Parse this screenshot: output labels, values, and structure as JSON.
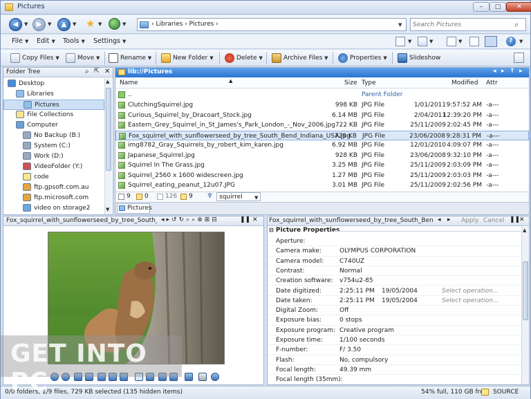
{
  "window": {
    "title": "Pictures",
    "min": "–",
    "max": "□",
    "close": "✕"
  },
  "address": {
    "crumbs": "›  Libraries  ›  Pictures  ›",
    "search_placeholder": "Search Pictures"
  },
  "menu": [
    "File",
    "Edit",
    "Tools",
    "Settings"
  ],
  "toolbar": [
    "Copy Files",
    "Move",
    "Rename",
    "New Folder",
    "Delete",
    "Archive Files",
    "Properties",
    "Slideshow"
  ],
  "tree": {
    "title": "Folder Tree",
    "items": [
      "Desktop",
      "Libraries",
      "Pictures",
      "File Collections",
      "Computer",
      "No Backup (B:)",
      "System (C:)",
      "Work (D:)",
      "VideoFolder (Y:)",
      "code",
      "ftp.gpsoft.com.au",
      "ftp.microsoft.com",
      "video on storage2"
    ]
  },
  "files": {
    "path": "lib://Pictures",
    "columns": [
      "Name",
      "Size",
      "Type",
      "Modified",
      "Attr"
    ],
    "parent": {
      "name": "..",
      "type": "Parent Folder"
    },
    "rows": [
      {
        "name": "ClutchingSquirrel.jpg",
        "size": "998 KB",
        "type": "JPG File",
        "date": "1/01/2011",
        "time": "9:57:52 AM",
        "attr": "-a---"
      },
      {
        "name": "Curious_Squirrel_by_Dracoart_Stock.jpg",
        "size": "6.14 MB",
        "type": "JPG File",
        "date": "2/04/2011",
        "time": "12:39:20 PM",
        "attr": "-a---"
      },
      {
        "name": "Eastern_Grey_Squirrel_in_St_James's_Park_London_-_Nov_2006.jpg",
        "size": "722 KB",
        "type": "JPG File",
        "date": "25/11/2009",
        "time": "2:02:45 PM",
        "attr": "-a---"
      },
      {
        "name": "Fox_squirrel_with_sunflowerseed_by_tree_South_Bend_Indiana_USA.jpg",
        "size": "729 KB",
        "type": "JPG File",
        "date": "23/06/2008",
        "time": "9:28:31 PM",
        "attr": "-a---"
      },
      {
        "name": "img8782_Gray_Squirrels_by_robert_kim_karen.jpg",
        "size": "6.92 MB",
        "type": "JPG File",
        "date": "12/01/2010",
        "time": "4:09:07 PM",
        "attr": "-a---"
      },
      {
        "name": "Japanese_Squirrel.jpg",
        "size": "928 KB",
        "type": "JPG File",
        "date": "23/06/2008",
        "time": "9:32:10 PM",
        "attr": "-a---"
      },
      {
        "name": "Squirrel In The Grass.jpg",
        "size": "3.25 MB",
        "type": "JPG File",
        "date": "25/11/2009",
        "time": "2:03:09 PM",
        "attr": "-a---"
      },
      {
        "name": "Squirrel_2560 x 1600 widescreen.jpg",
        "size": "1.27 MB",
        "type": "JPG File",
        "date": "25/11/2009",
        "time": "2:03:03 PM",
        "attr": "-a---"
      },
      {
        "name": "Squirrel_eating_peanut_12u07.JPG",
        "size": "3.01 MB",
        "type": "JPG File",
        "date": "25/11/2009",
        "time": "2:02:56 PM",
        "attr": "-a---"
      }
    ],
    "selected_index": 3,
    "counts": {
      "files": "9",
      "dirs": "0",
      "total": "126",
      "sel": "9"
    },
    "filter": "squirrel",
    "tab": "Pictures"
  },
  "preview": {
    "title": "Fox_squirrel_with_sunflowerseed_by_tree_South_Ben..."
  },
  "props": {
    "title": "Fox_squirrel_with_sunflowerseed_by_tree_South_Bend_India...",
    "apply": "Apply",
    "cancel": "Cancel",
    "section": "Picture Properties",
    "rows": [
      {
        "label": "Aperture:",
        "value": "",
        "value2": "",
        "op": ""
      },
      {
        "label": "Camera make:",
        "value": "OLYMPUS CORPORATION",
        "value2": "",
        "op": ""
      },
      {
        "label": "Camera model:",
        "value": "C740UZ",
        "value2": "",
        "op": ""
      },
      {
        "label": "Contrast:",
        "value": "Normal",
        "value2": "",
        "op": ""
      },
      {
        "label": "Creation software:",
        "value": "v754u2-85",
        "value2": "",
        "op": ""
      },
      {
        "label": "Date digitized:",
        "value": "  2:25:11 PM",
        "value2": "19/05/2004",
        "op": "Select operation..."
      },
      {
        "label": "Date taken:",
        "value": "  2:25:11 PM",
        "value2": "19/05/2004",
        "op": "Select operation..."
      },
      {
        "label": "Digital Zoom:",
        "value": "Off",
        "value2": "",
        "op": ""
      },
      {
        "label": "Exposure bias:",
        "value": "0     stops",
        "value2": "",
        "op": ""
      },
      {
        "label": "Exposure program:",
        "value": "Creative program",
        "value2": "",
        "op": ""
      },
      {
        "label": "Exposure time:",
        "value": "1/100       seconds",
        "value2": "",
        "op": ""
      },
      {
        "label": "F-number:",
        "value": "F/   3.50",
        "value2": "",
        "op": ""
      },
      {
        "label": "Flash:",
        "value": "No, compulsory",
        "value2": "",
        "op": ""
      },
      {
        "label": "Focal length:",
        "value": "49.39       mm",
        "value2": "",
        "op": ""
      },
      {
        "label": "Focal length (35mm):",
        "value": "",
        "value2": "",
        "op": ""
      }
    ]
  },
  "status": {
    "left": "0/0 folders, 1/9 files, 729 KB selected (135 hidden items)",
    "right": "54% full, 110 GB free",
    "source": "SOURCE"
  },
  "watermark": "GET INTO PC"
}
